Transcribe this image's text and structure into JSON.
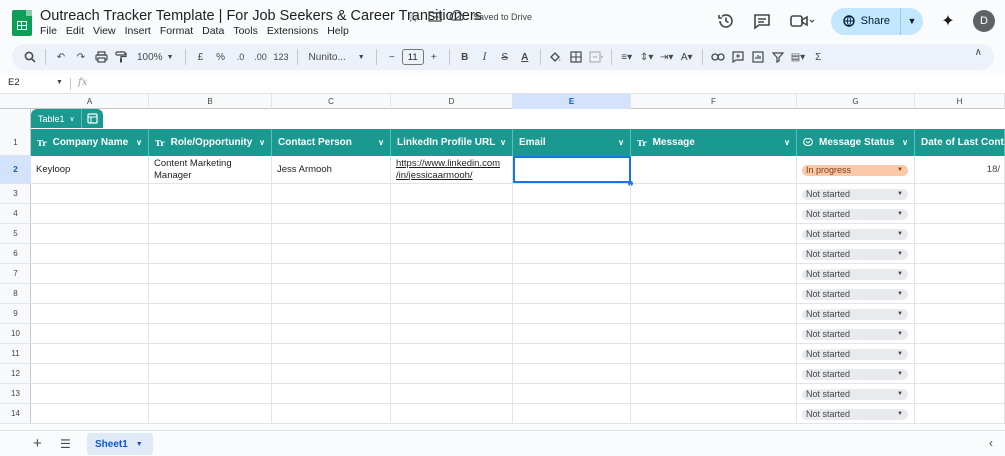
{
  "doc": {
    "title": "Outreach Tracker Template | For Job Seekers & Career Transitioners",
    "saved_status": "Saved to Drive"
  },
  "menus": [
    "File",
    "Edit",
    "View",
    "Insert",
    "Format",
    "Data",
    "Tools",
    "Extensions",
    "Help"
  ],
  "header_right": {
    "share_label": "Share",
    "avatar_letter": "D"
  },
  "toolbar": {
    "zoom": "100%",
    "currency": "£",
    "percent": "%",
    "decimals_less": ".0",
    "decimals_more": ".00",
    "number_format": "123",
    "font": "Nunito...",
    "font_size": "11",
    "minus": "−",
    "plus": "+"
  },
  "formula_bar": {
    "name_box": "E2",
    "fx": "fx",
    "value": ""
  },
  "columns": [
    "A",
    "B",
    "C",
    "D",
    "E",
    "F",
    "G",
    "H"
  ],
  "selected_column": "E",
  "table": {
    "name": "Table1",
    "headers": [
      {
        "label": "Company Name",
        "type_icon": "Tr"
      },
      {
        "label": "Role/Opportunity",
        "type_icon": "Tr"
      },
      {
        "label": "Contact Person",
        "type_icon": ""
      },
      {
        "label": "LinkedIn Profile URL",
        "type_icon": ""
      },
      {
        "label": "Email",
        "type_icon": ""
      },
      {
        "label": "Message",
        "type_icon": "Tr"
      },
      {
        "label": "Message Status",
        "type_icon": "chip"
      },
      {
        "label": "Date of Last Cont",
        "type_icon": ""
      }
    ]
  },
  "row_numbers": [
    "1",
    "2",
    "3",
    "4",
    "5",
    "6",
    "7",
    "8",
    "9",
    "10",
    "11",
    "12",
    "13",
    "14"
  ],
  "selected_row": "2",
  "rows": [
    {
      "company": "Keyloop",
      "role_line1": "Content Marketing",
      "role_line2": "Manager",
      "contact": "Jess Armooh",
      "url_line1": "https://www.linkedin.com",
      "url_line2": "/in/jessicaarmooh/",
      "email": "",
      "message": "",
      "status": "In progress",
      "date": "18/"
    }
  ],
  "empty_status": "Not started",
  "sheet_tab": "Sheet1"
}
